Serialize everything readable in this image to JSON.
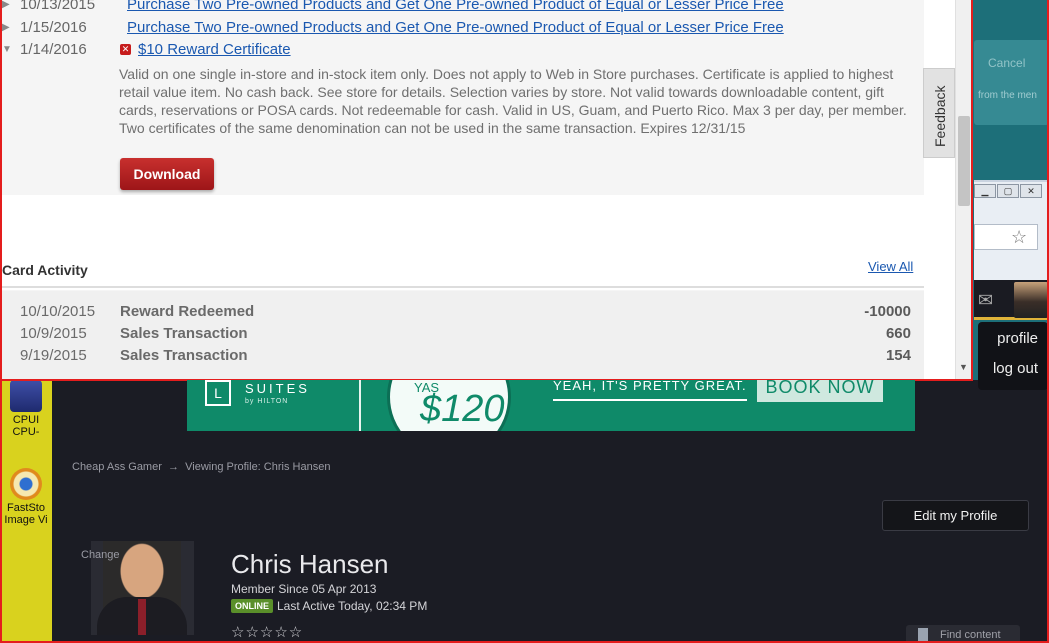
{
  "offers": [
    {
      "date": "10/13/2015",
      "title": "Purchase Two Pre-owned Products and Get One Pre-owned Product of Equal or Lesser Price Free"
    },
    {
      "date": "1/15/2016",
      "title": "Purchase Two Pre-owned Products and Get One Pre-owned Product of Equal or Lesser Price Free"
    },
    {
      "date": "1/14/2016",
      "title": "$10 Reward Certificate"
    }
  ],
  "certificate": {
    "description": "Valid on one single in-store and in-stock item only. Does not apply to Web in Store purchases. Certificate is applied to highest retail value item. No cash back. See store for details. Selection varies by store. Not valid towards downloadable content, gift cards, reservations or POSA cards. Not redeemable for cash. Valid in US, Guam, and Puerto Rico. Max 3 per day, per member. Two certificates of the same denomination can not be used in the same transaction. Expires 12/31/15",
    "download_label": "Download"
  },
  "card_activity": {
    "title": "Card Activity",
    "view_all": "View All",
    "rows": [
      {
        "date": "10/10/2015",
        "type": "Reward Redeemed",
        "points": "-10000"
      },
      {
        "date": "10/9/2015",
        "type": "Sales Transaction",
        "points": "660"
      },
      {
        "date": "9/19/2015",
        "type": "Sales Transaction",
        "points": "154"
      }
    ]
  },
  "feedback_label": "Feedback",
  "desktop": {
    "icon1_label": "CPUI\nCPU-",
    "icon2_label": "FastSto\nImage Vi"
  },
  "behind_window": {
    "cancel": "Cancel",
    "hint": "from the men",
    "profile": "profile",
    "logout": "log out"
  },
  "ad": {
    "brand": "SUITES",
    "by": "by HILTON",
    "price": "$120",
    "price_top": "YAS",
    "tagline": "YEAH, IT'S PRETTY GREAT.",
    "cta": "BOOK NOW"
  },
  "profile": {
    "breadcrumb_site": "Cheap Ass Gamer",
    "breadcrumb_arrow": "→",
    "breadcrumb_page": "Viewing Profile: Chris Hansen",
    "edit_label": "Edit my Profile",
    "change_label": "Change",
    "name": "Chris Hansen",
    "member_since": "Member Since 05 Apr 2013",
    "online_badge": "ONLINE",
    "last_active": "Last Active Today, 02:34 PM",
    "rating_stars": "☆☆☆☆☆",
    "find_content": "Find content"
  }
}
